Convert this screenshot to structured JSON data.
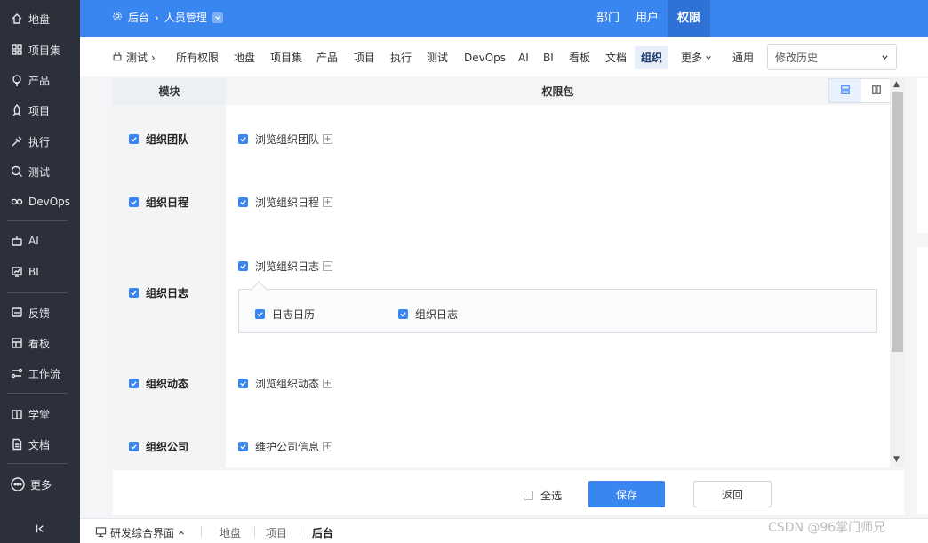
{
  "sidebar": {
    "items": [
      {
        "label": "地盘",
        "icon": "home-icon"
      },
      {
        "label": "项目集",
        "icon": "grid-icon"
      },
      {
        "label": "产品",
        "icon": "bulb-icon"
      },
      {
        "label": "项目",
        "icon": "rocket-icon"
      },
      {
        "label": "执行",
        "icon": "execute-icon"
      },
      {
        "label": "测试",
        "icon": "search-icon"
      },
      {
        "label": "DevOps",
        "icon": "infinity-icon"
      },
      {
        "label": "AI",
        "icon": "robot-icon"
      },
      {
        "label": "BI",
        "icon": "chart-icon"
      },
      {
        "label": "反馈",
        "icon": "feedback-icon"
      },
      {
        "label": "看板",
        "icon": "kanban-icon"
      },
      {
        "label": "工作流",
        "icon": "workflow-icon"
      },
      {
        "label": "学堂",
        "icon": "school-icon"
      },
      {
        "label": "文档",
        "icon": "document-icon"
      },
      {
        "label": "更多",
        "icon": "more-icon"
      }
    ]
  },
  "header": {
    "breadcrumb": {
      "root": "后台",
      "current": "人员管理"
    },
    "tabs": [
      {
        "label": "部门",
        "active": false
      },
      {
        "label": "用户",
        "active": false
      },
      {
        "label": "权限",
        "active": true
      }
    ],
    "accent_color": "#3a86f0"
  },
  "subnav": {
    "group": "测试",
    "tabs": [
      {
        "label": "所有权限"
      },
      {
        "label": "地盘"
      },
      {
        "label": "项目集"
      },
      {
        "label": "产品"
      },
      {
        "label": "项目"
      },
      {
        "label": "执行"
      },
      {
        "label": "测试"
      },
      {
        "label": "DevOps"
      },
      {
        "label": "AI"
      },
      {
        "label": "BI"
      },
      {
        "label": "看板"
      },
      {
        "label": "文档"
      },
      {
        "label": "组织",
        "active": true
      },
      {
        "label": "更多"
      },
      {
        "label": "通用"
      }
    ],
    "history_select": "修改历史"
  },
  "table": {
    "col_module": "模块",
    "col_perms": "权限包",
    "rows": [
      {
        "module": "组织团队",
        "perms": [
          {
            "label": "浏览组织团队",
            "expander": "+"
          }
        ]
      },
      {
        "module": "组织日程",
        "perms": [
          {
            "label": "浏览组织日程",
            "expander": "+"
          }
        ]
      },
      {
        "module": "组织日志",
        "perms": [
          {
            "label": "浏览组织日志",
            "expander": "−"
          }
        ],
        "sub": [
          {
            "label": "日志日历"
          },
          {
            "label": "组织日志"
          }
        ]
      },
      {
        "module": "组织动态",
        "perms": [
          {
            "label": "浏览组织动态",
            "expander": "+"
          }
        ]
      },
      {
        "module": "组织公司",
        "perms": [
          {
            "label": "维护公司信息",
            "expander": "+"
          }
        ]
      }
    ]
  },
  "actions": {
    "select_all": "全选",
    "save": "保存",
    "back": "返回"
  },
  "footer": {
    "main": "研发综合界面",
    "tabs": [
      {
        "label": "地盘",
        "active": false
      },
      {
        "label": "项目",
        "active": false
      },
      {
        "label": "后台",
        "active": true
      }
    ]
  },
  "watermark": "CSDN @96掌门师兄"
}
